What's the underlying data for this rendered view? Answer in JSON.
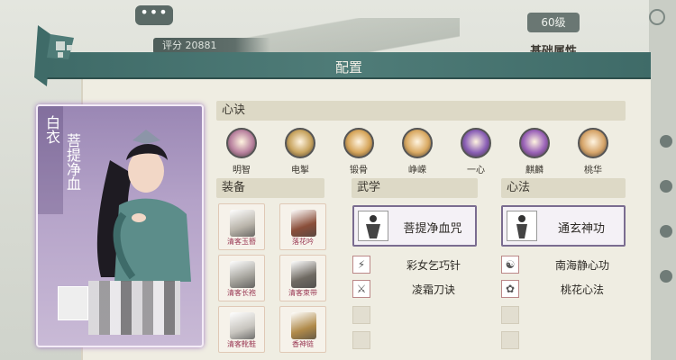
{
  "background": {
    "chat_icon": "chat-bubble-icon",
    "chat_text": "•••",
    "score": "评分 20881",
    "level": "60级",
    "attributes_title": "基础属性"
  },
  "dialog": {
    "title": "配置"
  },
  "character": {
    "title": "白衣",
    "name": "菩提净血"
  },
  "sections": {
    "skills": "心诀",
    "equipment": "装备",
    "martial": "武学",
    "inner": "心法"
  },
  "skills": [
    {
      "label": "明智",
      "icon": "eye-orb-icon",
      "color": "#b9829f"
    },
    {
      "label": "电掣",
      "icon": "lightning-l-icon",
      "color": "#c7a35e"
    },
    {
      "label": "锻骨",
      "icon": "sun-burst-icon",
      "color": "#d6a55a"
    },
    {
      "label": "峥嵘",
      "icon": "cloud-orb-icon",
      "color": "#d9a962"
    },
    {
      "label": "一心",
      "icon": "purple-flame-icon",
      "color": "#8a5fb6"
    },
    {
      "label": "麒麟",
      "icon": "qilin-icon",
      "color": "#9a62b8"
    },
    {
      "label": "桃华",
      "icon": "peach-blossom-icon",
      "color": "#d6a56a"
    }
  ],
  "equipment": [
    {
      "label": "清客玉簪",
      "icon": "hairpin-icon",
      "color": "#b9b4aa"
    },
    {
      "label": "落花吟",
      "icon": "staff-icon",
      "color": "#8a4f3a"
    },
    {
      "label": "清客长袍",
      "icon": "robe-icon",
      "color": "#a5a39c"
    },
    {
      "label": "清客束带",
      "icon": "belt-icon",
      "color": "#6f6a62"
    },
    {
      "label": "清客靴鞋",
      "icon": "boots-icon",
      "color": "#c8c5bf"
    },
    {
      "label": "香神链",
      "icon": "necklace-icon",
      "color": "#b08a4a"
    }
  ],
  "martial": {
    "main": "菩提净血咒",
    "subs": [
      "彩女乞巧针",
      "凌霜刀诀"
    ]
  },
  "inner": {
    "main": "通玄神功",
    "subs": [
      "南海静心功",
      "桃花心法"
    ]
  }
}
